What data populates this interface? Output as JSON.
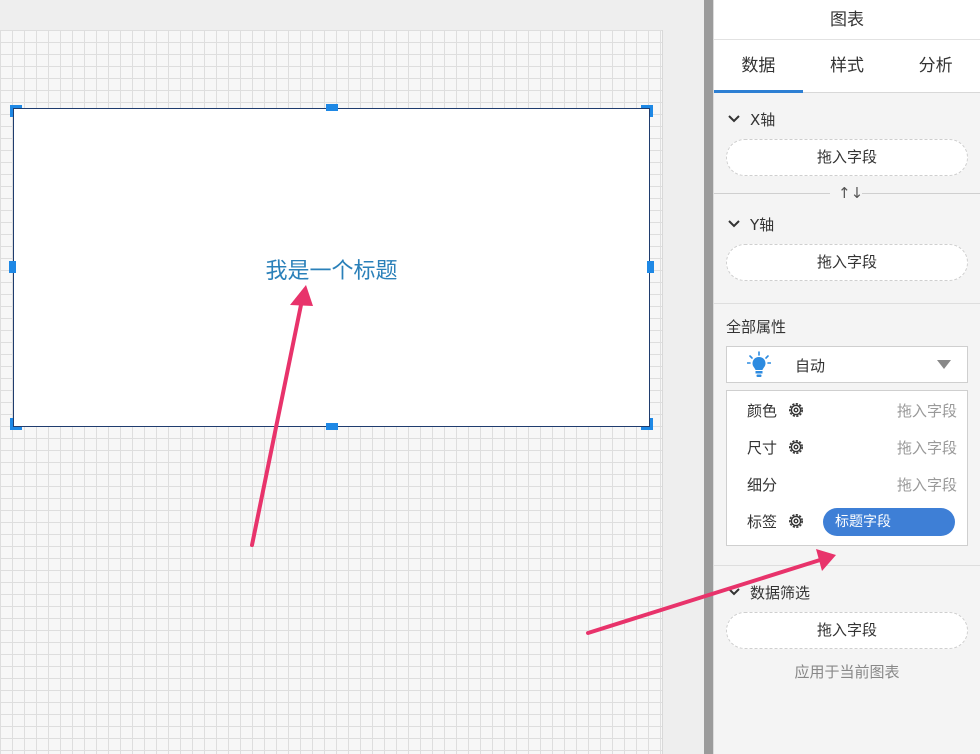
{
  "canvas": {
    "widget_title": "我是一个标题"
  },
  "panel": {
    "title": "图表",
    "tabs": [
      {
        "label": "数据",
        "active": true
      },
      {
        "label": "样式",
        "active": false
      },
      {
        "label": "分析",
        "active": false
      }
    ],
    "x_axis": {
      "label": "X轴",
      "drop_label": "拖入字段"
    },
    "swap_icon": "↑↓",
    "y_axis": {
      "label": "Y轴",
      "drop_label": "拖入字段"
    },
    "all_attrs": {
      "title": "全部属性",
      "select_value": "自动",
      "select_icon": "lightbulb-icon",
      "rows": [
        {
          "label": "颜色",
          "drop_label": "拖入字段",
          "has_gear": true
        },
        {
          "label": "尺寸",
          "drop_label": "拖入字段",
          "has_gear": true
        },
        {
          "label": "细分",
          "drop_label": "拖入字段",
          "has_gear": false
        },
        {
          "label": "标签",
          "pill_label": "标题字段",
          "has_gear": true
        }
      ]
    },
    "filter": {
      "label": "数据筛选",
      "drop_label": "拖入字段",
      "apply_text": "应用于当前图表"
    }
  },
  "colors": {
    "accent": "#2d7fd3",
    "pill": "#3e7fd6",
    "annotation_arrow": "#e8336b",
    "widget_title": "#2a80b9"
  }
}
